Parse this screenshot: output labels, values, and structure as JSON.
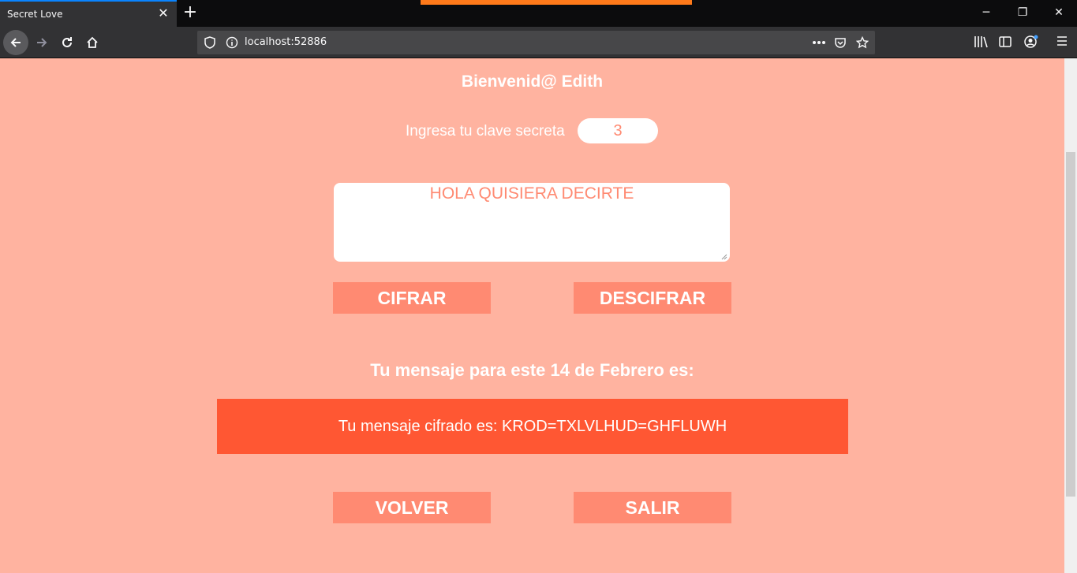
{
  "browser": {
    "tab_title": "Secret Love",
    "url": "localhost:52886"
  },
  "page": {
    "welcome": "Bienvenid@ Edith",
    "key_label": "Ingresa tu clave secreta",
    "key_value": "3",
    "message_value": "HOLA QUISIERA DECIRTE",
    "encrypt_label": "CIFRAR",
    "decrypt_label": "DESCIFRAR",
    "result_heading": "Tu mensaje para este 14 de Febrero es:",
    "result_text": "Tu mensaje cifrado es: KROD=TXLVLHUD=GHFLUWH",
    "back_label": "VOLVER",
    "exit_label": "SALIR"
  },
  "colors": {
    "background": "#ffb3a0",
    "button": "#ff8a72",
    "result_box": "#ff5733",
    "text": "#ffffff"
  },
  "icons": [
    "back-arrow-icon",
    "forward-arrow-icon",
    "reload-icon",
    "home-icon",
    "shield-icon",
    "info-icon",
    "more-icon",
    "pocket-icon",
    "star-icon",
    "library-icon",
    "sidebar-icon",
    "account-icon",
    "menu-icon",
    "close-icon",
    "plus-icon"
  ]
}
